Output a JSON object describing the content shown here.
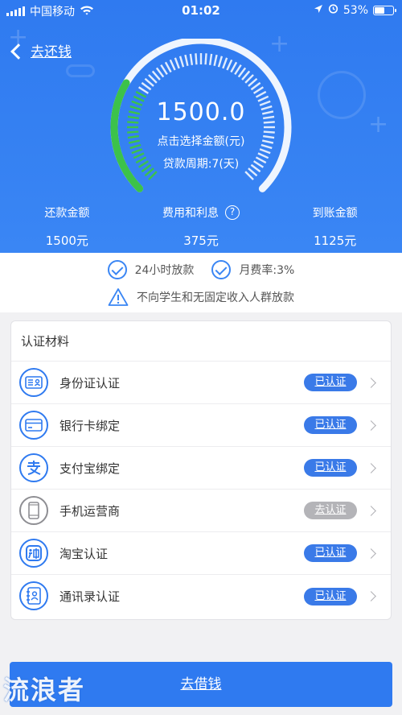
{
  "status": {
    "carrier": "中国移动",
    "time": "01:02",
    "battery": "53%",
    "battery_level": 0.53
  },
  "header": {
    "back_label": "去还钱",
    "amount": "1500.0",
    "hint": "点击选择金额(元)",
    "period": "贷款周期:7(天)",
    "gauge_progress": 0.28
  },
  "stats": [
    {
      "label": "还款金额",
      "value": "1500元"
    },
    {
      "label": "费用和利息",
      "value": "375元"
    },
    {
      "label": "到账金额",
      "value": "1125元"
    }
  ],
  "features": {
    "f1": "24小时放款",
    "f2": "月费率:3%",
    "notice": "不向学生和无固定收入人群放款"
  },
  "verification": {
    "title": "认证材料",
    "items": [
      {
        "label": "身份证认证",
        "status": "已认证",
        "icon": "id-card-icon"
      },
      {
        "label": "银行卡绑定",
        "status": "已认证",
        "icon": "bank-card-icon"
      },
      {
        "label": "支付宝绑定",
        "status": "已认证",
        "icon": "alipay-icon"
      },
      {
        "label": "手机运营商",
        "status": "去认证",
        "icon": "phone-icon"
      },
      {
        "label": "淘宝认证",
        "status": "已认证",
        "icon": "taobao-icon"
      },
      {
        "label": "通讯录认证",
        "status": "已认证",
        "icon": "contacts-icon"
      }
    ]
  },
  "cta_label": "去借钱",
  "watermark": "流浪者",
  "colors": {
    "primary": "#2f7af0",
    "progress": "#3cc24a",
    "badge": "#3a7ae8",
    "badge_disabled": "#b4b4b8"
  }
}
